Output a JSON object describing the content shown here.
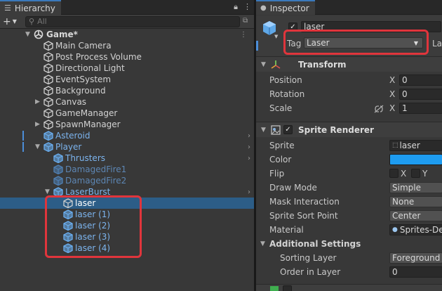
{
  "hierarchy": {
    "tab_label": "Hierarchy",
    "search_placeholder": "All",
    "scene_name": "Game*",
    "items": [
      {
        "label": "Main Camera"
      },
      {
        "label": "Post Process Volume"
      },
      {
        "label": "Directional Light"
      },
      {
        "label": "EventSystem"
      },
      {
        "label": "Background"
      },
      {
        "label": "Canvas"
      },
      {
        "label": "GameManager"
      },
      {
        "label": "SpawnManager"
      },
      {
        "label": "Asteroid"
      },
      {
        "label": "Player"
      },
      {
        "label": "Thrusters"
      },
      {
        "label": "DamagedFire1"
      },
      {
        "label": "DamagedFire2"
      },
      {
        "label": "LaserBurst"
      },
      {
        "label": "laser"
      },
      {
        "label": "laser (1)"
      },
      {
        "label": "laser (2)"
      },
      {
        "label": "laser (3)"
      },
      {
        "label": "laser (4)"
      }
    ]
  },
  "inspector": {
    "tab_label": "Inspector",
    "object_name": "laser",
    "tag_label": "Tag",
    "tag_value": "Laser",
    "layer_label_partial": "La",
    "transform": {
      "title": "Transform",
      "position_label": "Position",
      "rotation_label": "Rotation",
      "scale_label": "Scale",
      "x_label": "X",
      "position_x": "0",
      "rotation_x": "0",
      "scale_x": "1"
    },
    "sprite_renderer": {
      "title": "Sprite Renderer",
      "sprite_label": "Sprite",
      "sprite_value": "laser",
      "color_label": "Color",
      "color_value": "#1e9cf0",
      "flip_label": "Flip",
      "flip_x": "X",
      "flip_y": "Y",
      "draw_mode_label": "Draw Mode",
      "draw_mode_value": "Simple",
      "mask_label": "Mask Interaction",
      "mask_value": "None",
      "sort_point_label": "Sprite Sort Point",
      "sort_point_value": "Center",
      "material_label": "Material",
      "material_value": "Sprites-De",
      "additional_settings": "Additional Settings",
      "sorting_layer_label": "Sorting Layer",
      "sorting_layer_value": "Foreground",
      "order_label": "Order in Layer",
      "order_value": "0"
    }
  }
}
